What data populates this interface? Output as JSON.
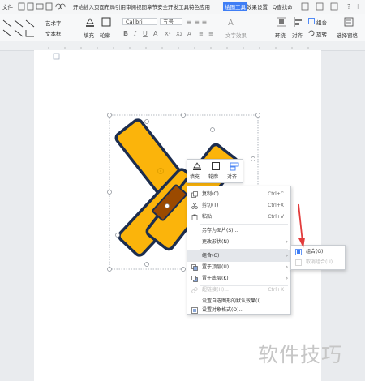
{
  "menubar": {
    "file": "文件",
    "tabs_text": "开始插入页面布局引用审阅视图章节安全开发工具特色应用",
    "active_tab": "绘图工具",
    "tab_effects": "效果设置",
    "search": "Q查找命"
  },
  "ribbon": {
    "art_style": "艺术字",
    "text_box": "文本框",
    "fill": "填充",
    "outline": "轮廓",
    "font_name": "Calibri",
    "font_size": "五号",
    "text_effect": "文字效果",
    "wrap": "环绕",
    "align": "对齐",
    "group": "组合",
    "rotate": "旋转",
    "selection_pane": "选择窗格"
  },
  "float_toolbar": {
    "fill": "填充",
    "outline": "轮廓",
    "align": "对齐"
  },
  "context_menu": {
    "items": [
      {
        "label": "复制(C)",
        "shortcut": "Ctrl+C"
      },
      {
        "label": "剪切(T)",
        "shortcut": "Ctrl+X"
      },
      {
        "label": "粘贴",
        "shortcut": "Ctrl+V"
      },
      {
        "label": "另存为图片(S)..."
      },
      {
        "label": "更改形状(N)"
      },
      {
        "label": "组合(G)"
      },
      {
        "label": "置于顶层(U)"
      },
      {
        "label": "置于底层(K)"
      },
      {
        "label": "超链接(H)...",
        "shortcut": "Ctrl+K"
      },
      {
        "label": "设置自选图形的默认效果(I)"
      },
      {
        "label": "设置对象格式(O)..."
      }
    ]
  },
  "submenu": {
    "group": "组合(G)",
    "ungroup": "取消组合(U)"
  },
  "watermark": "软件技巧",
  "colors": {
    "shape_fill": "#fbb40b",
    "shape_stroke": "#1c2d4f",
    "overlap_fill": "#9b4a00",
    "accent": "#3f7ef5",
    "arrow": "#e23c3c"
  }
}
